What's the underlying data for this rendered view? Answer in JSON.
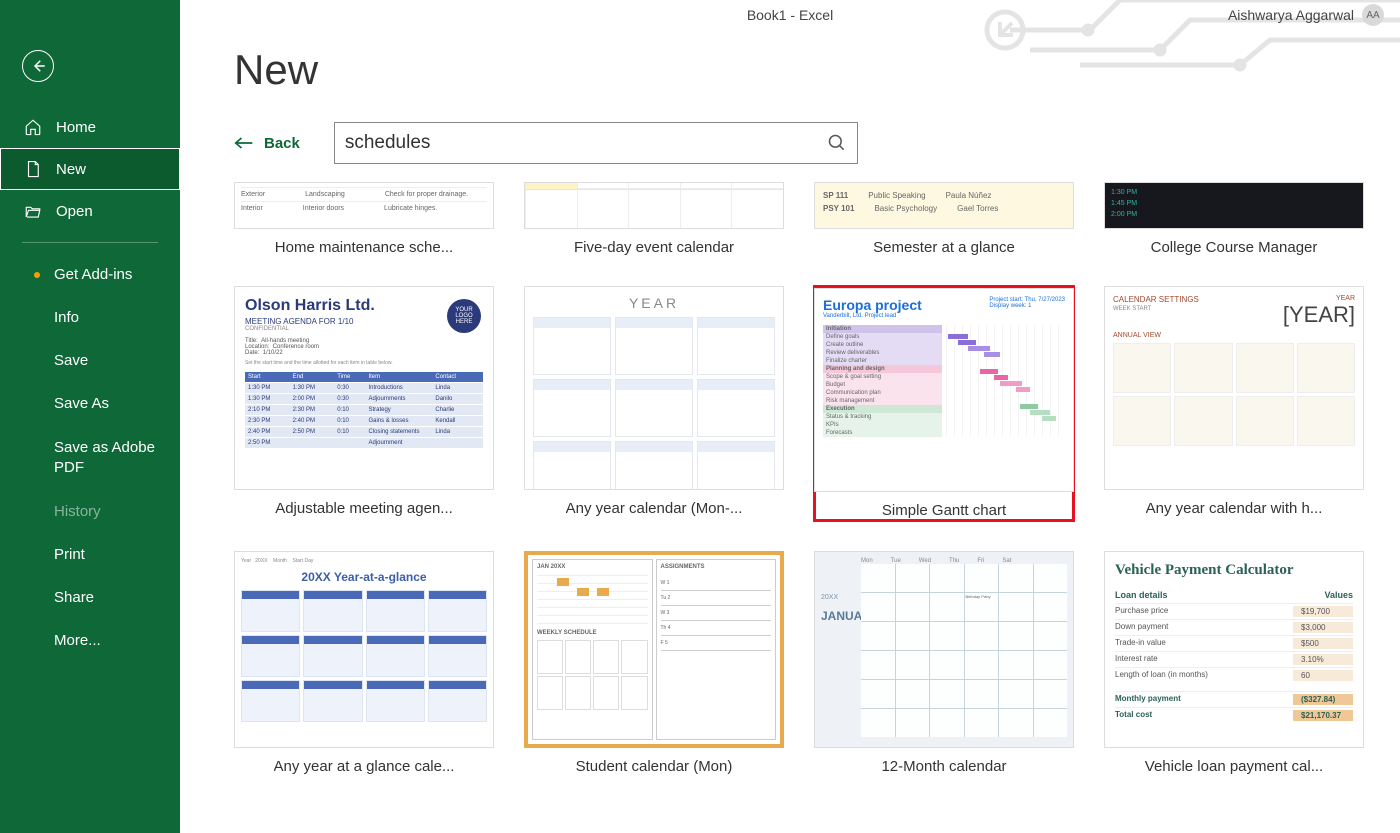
{
  "titlebar": {
    "title": "Book1  -  Excel"
  },
  "user": {
    "name": "Aishwarya Aggarwal",
    "initials": "AA"
  },
  "sidebar": {
    "items": [
      {
        "label": "Home"
      },
      {
        "label": "New"
      },
      {
        "label": "Open"
      }
    ],
    "subitems": [
      {
        "label": "Get Add-ins"
      },
      {
        "label": "Info"
      },
      {
        "label": "Save"
      },
      {
        "label": "Save As"
      },
      {
        "label": "Save as Adobe PDF"
      },
      {
        "label": "History"
      },
      {
        "label": "Print"
      },
      {
        "label": "Share"
      },
      {
        "label": "More..."
      }
    ]
  },
  "page": {
    "title": "New",
    "back_label": "Back"
  },
  "search": {
    "value": "schedules"
  },
  "templates": {
    "row1": [
      {
        "label": "Home maintenance sche..."
      },
      {
        "label": "Five-day event calendar"
      },
      {
        "label": "Semester at a glance"
      },
      {
        "label": "College Course Manager"
      }
    ],
    "row2": [
      {
        "label": "Adjustable meeting agen..."
      },
      {
        "label": "Any year calendar (Mon-..."
      },
      {
        "label": "Simple Gantt chart"
      },
      {
        "label": "Any year calendar with h..."
      }
    ],
    "row3": [
      {
        "label": "Any year at a glance cale..."
      },
      {
        "label": "Student calendar (Mon)"
      },
      {
        "label": "12-Month calendar"
      },
      {
        "label": "Vehicle loan payment cal..."
      }
    ]
  },
  "thumbs": {
    "home_maint": [
      [
        "Exterior",
        "Landscaping",
        "Check for proper drainage."
      ],
      [
        "Interior",
        "Interior doors",
        "Lubricate hinges."
      ]
    ],
    "sem": [
      [
        "SP 111",
        "Public Speaking",
        "Paula Núñez"
      ],
      [
        "PSY 101",
        "Basic Psychology",
        "Gael Torres"
      ]
    ],
    "ccm": [
      "1:30 PM",
      "1:45 PM",
      "2:00 PM"
    ],
    "olson": {
      "company": "Olson Harris Ltd.",
      "sub": "MEETING AGENDA FOR 1/10",
      "conf": "CONFIDENTIAL",
      "logo": "YOUR LOGO HERE",
      "meta": [
        [
          "Title:",
          "All-hands meeting"
        ],
        [
          "Location:",
          "Conference room"
        ],
        [
          "Date:",
          "1/10/22"
        ]
      ],
      "note": "Set the start time and the time allotted for each item in table below.",
      "hdr": [
        "Start",
        "End",
        "Time",
        "Item",
        "Contact"
      ],
      "rows": [
        [
          "1:30 PM",
          "1:30 PM",
          "0:30",
          "Introductions",
          "Linda"
        ],
        [
          "1:30 PM",
          "2:00 PM",
          "0:30",
          "Adjournments",
          "Danilo"
        ],
        [
          "2:10 PM",
          "2:30 PM",
          "0:10",
          "Strategy",
          "Charlie"
        ],
        [
          "2:30 PM",
          "2:40 PM",
          "0:10",
          "Gains & losses",
          "Kendall"
        ],
        [
          "2:40 PM",
          "2:50 PM",
          "0:10",
          "Closing statements",
          "Linda"
        ],
        [
          "2:50 PM",
          "",
          "",
          "Adjournment",
          ""
        ]
      ]
    },
    "year_title": "YEAR",
    "gantt": {
      "title": "Europa project",
      "sub1": "Vanderbilt, Ltd.   Project lead",
      "right1": "Project start:    Thu, 7/27/2023",
      "right2": "Display week:   1"
    },
    "anyyear": {
      "s1": "CALENDAR SETTINGS",
      "big": "[YEAR]",
      "w": "WEEK START",
      "a": "ANNUAL VIEW"
    },
    "twentyxx": "20XX Year-at-a-glance",
    "student": {
      "jan": "JAN 20XX",
      "ws": "WEEKLY SCHEDULE",
      "as": "ASSIGNMENTS"
    },
    "twelve": {
      "y": "20XX",
      "m": "JANUARY",
      "days": [
        "Mon",
        "Tue",
        "Wed",
        "Thu",
        "Fri",
        "Sat"
      ]
    },
    "vehicle": {
      "title": "Vehicle Payment Calculator",
      "h": [
        "Loan details",
        "Values"
      ],
      "rows": [
        [
          "Purchase price",
          "$19,700"
        ],
        [
          "Down payment",
          "$3,000"
        ],
        [
          "Trade-in value",
          "$500"
        ],
        [
          "Interest rate",
          "3.10%"
        ],
        [
          "Length of loan (in months)",
          "60"
        ]
      ],
      "em": [
        [
          "Monthly payment",
          "($327.84)"
        ],
        [
          "Total cost",
          "$21,170.37"
        ]
      ]
    }
  }
}
